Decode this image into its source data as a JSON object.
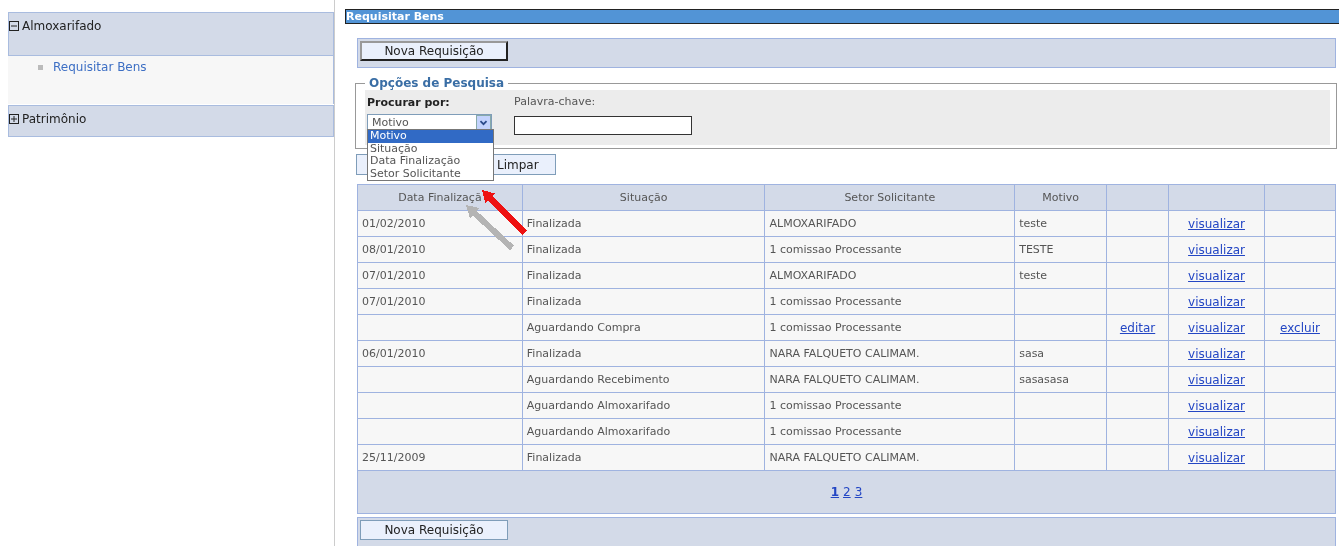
{
  "sidebar": {
    "groups": [
      {
        "label": "Almoxarifado",
        "expanded": true,
        "items": [
          {
            "label": "Requisitar Bens"
          }
        ]
      },
      {
        "label": "Patrimônio",
        "expanded": false
      }
    ]
  },
  "page": {
    "title": "Requisitar Bens",
    "new_button": "Nova Requisição",
    "bottom_button": "Nova Requisição"
  },
  "search": {
    "legend": "Opções de Pesquisa",
    "search_by_label": "Procurar por:",
    "search_by_value": "Motivo",
    "options": [
      {
        "label": "Motivo",
        "selected": true
      },
      {
        "label": "Situação",
        "selected": false
      },
      {
        "label": "Data Finalização",
        "selected": false
      },
      {
        "label": "Setor Solicitante",
        "selected": false
      }
    ],
    "keyword_label": "Palavra-chave:",
    "clear_button": "Limpar"
  },
  "table": {
    "columns": [
      "Data Finalizaçã",
      "Situação",
      "Setor Solicitante",
      "Motivo"
    ],
    "rows": [
      {
        "date": "01/02/2010",
        "status": "Finalizada",
        "sector": "ALMOXARIFADO",
        "reason": "teste",
        "view": "visualizar"
      },
      {
        "date": "08/01/2010",
        "status": "Finalizada",
        "sector": "1 comissao Processante",
        "reason": "TESTE",
        "view": "visualizar"
      },
      {
        "date": "07/01/2010",
        "status": "Finalizada",
        "sector": "ALMOXARIFADO",
        "reason": "teste",
        "view": "visualizar"
      },
      {
        "date": "07/01/2010",
        "status": "Finalizada",
        "sector": "1 comissao Processante",
        "view": "visualizar"
      },
      {
        "status": "Aguardando Compra",
        "sector": "1 comissao Processante",
        "edit": "editar",
        "view": "visualizar",
        "delete": "excluir"
      },
      {
        "date": "06/01/2010",
        "status": "Finalizada",
        "sector": "NARA FALQUETO CALIMAM.",
        "reason": "sasa",
        "view": "visualizar"
      },
      {
        "status": "Aguardando Recebimento",
        "sector": "NARA FALQUETO CALIMAM.",
        "reason": "sasasasa",
        "view": "visualizar"
      },
      {
        "status": "Aguardando Almoxarifado",
        "sector": "1 comissao Processante",
        "view": "visualizar"
      },
      {
        "status": "Aguardando Almoxarifado",
        "sector": "1 comissao Processante",
        "view": "visualizar"
      },
      {
        "date": "25/11/2009",
        "status": "Finalizada",
        "sector": "NARA FALQUETO CALIMAM.",
        "view": "visualizar"
      }
    ],
    "pages": [
      {
        "label": "1",
        "selected": true
      },
      {
        "label": "2",
        "selected": false
      },
      {
        "label": "3",
        "selected": false
      }
    ]
  },
  "annotations": [
    {
      "kind": "arrow",
      "color": "#ee1111"
    },
    {
      "kind": "arrow",
      "color": "#b4b4b4"
    }
  ]
}
